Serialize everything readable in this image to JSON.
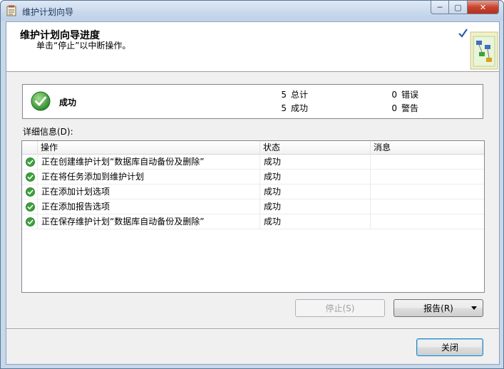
{
  "window": {
    "title": "维护计划向导",
    "controls": {
      "minimize": "─",
      "maximize": "▢",
      "close": "✕"
    }
  },
  "header": {
    "title": "维护计划向导进度",
    "subtitle": "单击“停止”以中断操作。"
  },
  "summary": {
    "status": "成功",
    "stats": {
      "total_count": "5",
      "total_label": "总计",
      "success_count": "5",
      "success_label": "成功",
      "error_count": "0",
      "error_label": "错误",
      "warning_count": "0",
      "warning_label": "警告"
    }
  },
  "details_label": "详细信息(D):",
  "grid": {
    "columns": [
      "操作",
      "状态",
      "消息"
    ],
    "rows": [
      {
        "action": "正在创建维护计划“数据库自动备份及删除”",
        "status": "成功",
        "message": ""
      },
      {
        "action": "正在将任务添加到维护计划",
        "status": "成功",
        "message": ""
      },
      {
        "action": "正在添加计划选项",
        "status": "成功",
        "message": ""
      },
      {
        "action": "正在添加报告选项",
        "status": "成功",
        "message": ""
      },
      {
        "action": "正在保存维护计划“数据库自动备份及删除”",
        "status": "成功",
        "message": ""
      }
    ]
  },
  "buttons": {
    "stop": "停止(S)",
    "report": "报告(R)",
    "close": "关闭"
  },
  "colors": {
    "success": "#2e9a2e",
    "accent": "#3c7fb1"
  }
}
